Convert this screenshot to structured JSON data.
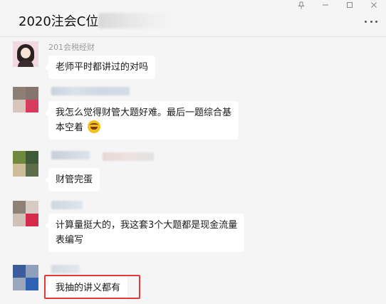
{
  "window": {
    "pin_icon": "pin-icon",
    "minimize_icon": "minimize-icon",
    "maximize_icon": "maximize-icon",
    "close_icon": "close-icon"
  },
  "chat": {
    "title": "2020注会C位",
    "more_icon": "more-icon"
  },
  "messages": [
    {
      "sender": "201会税经财",
      "lines": [
        "老师平时都讲过的对吗"
      ]
    },
    {
      "sender": "",
      "lines": [
        "我怎么觉得财管大题好难。最后一题综合基",
        "本空着"
      ],
      "emoji": "face-with-tears-of-joy"
    },
    {
      "sender": "",
      "lines": [
        "财管完蛋"
      ]
    },
    {
      "sender": "",
      "lines": [
        "计算量挺大的，我这套3个大题都是现金流量",
        "表编写"
      ]
    },
    {
      "sender": "",
      "lines": [
        "我抽的讲义都有"
      ]
    }
  ],
  "colors": {
    "background": "#f5f5f5",
    "bubble": "#ffffff",
    "highlight_border": "#e03a3a",
    "sender_text": "#9c9c9c"
  }
}
